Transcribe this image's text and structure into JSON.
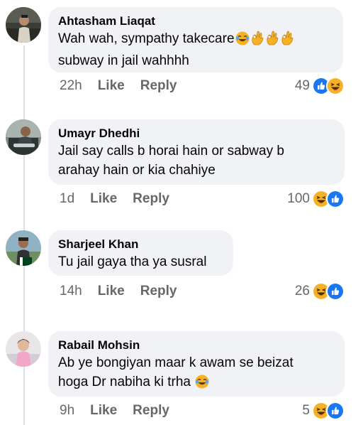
{
  "comments": [
    {
      "author": "Ahtasham Liaqat",
      "lines": [
        "Wah wah, sympathy takecare",
        "subway in jail wahhhh"
      ],
      "time": "22h",
      "like": "Like",
      "reply": "Reply",
      "reaction_count": "49",
      "reaction_icons": [
        "like-reaction-icon",
        "haha-reaction-icon"
      ]
    },
    {
      "author": "Umayr Dhedhi",
      "lines": [
        "Jail say calls b horai hain or sabway b",
        "arahay hain or kia chahiye"
      ],
      "time": "1d",
      "like": "Like",
      "reply": "Reply",
      "reaction_count": "100",
      "reaction_icons": [
        "haha-reaction-icon",
        "like-reaction-icon"
      ]
    },
    {
      "author": "Sharjeel Khan",
      "lines": [
        "Tu jail gaya tha ya susral"
      ],
      "time": "14h",
      "like": "Like",
      "reply": "Reply",
      "reaction_count": "26",
      "reaction_icons": [
        "haha-reaction-icon",
        "like-reaction-icon"
      ]
    },
    {
      "author": "Rabail Mohsin",
      "lines": [
        "Ab ye bongiyan maar k awam se beizat",
        "hoga Dr nabiha ki trha"
      ],
      "time": "9h",
      "like": "Like",
      "reply": "Reply",
      "reaction_count": "5",
      "reaction_icons": [
        "haha-reaction-icon",
        "like-reaction-icon"
      ]
    }
  ],
  "colors": {
    "bubble": "#f0f2f5",
    "meta_text": "#65676b",
    "like_blue": "#1877f2",
    "haha_yellow": "#f7b125"
  }
}
